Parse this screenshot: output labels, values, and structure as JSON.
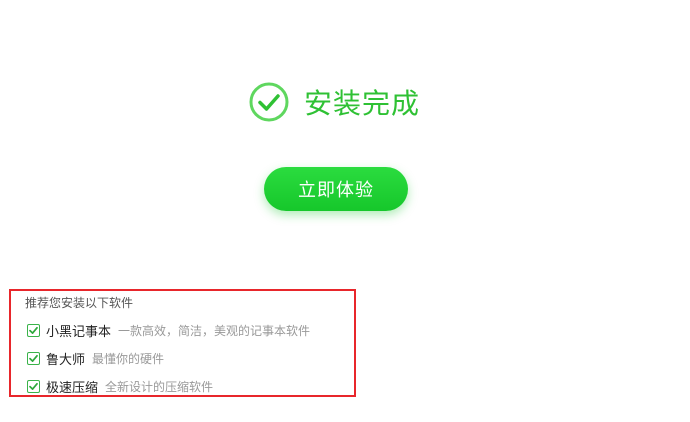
{
  "status": {
    "icon": "check-circle-icon",
    "title": "安装完成"
  },
  "cta": {
    "label": "立即体验"
  },
  "recommend": {
    "title": "推荐您安装以下软件",
    "items": [
      {
        "name": "小黑记事本",
        "desc": "一款高效，简洁，美观的记事本软件",
        "checked": true
      },
      {
        "name": "鲁大师",
        "desc": "最懂你的硬件",
        "checked": true
      },
      {
        "name": "极速压缩",
        "desc": "全新设计的压缩软件",
        "checked": true
      }
    ]
  },
  "colors": {
    "accent": "#2fc134",
    "button": "#16c72b",
    "highlight_border": "#e8262b"
  }
}
